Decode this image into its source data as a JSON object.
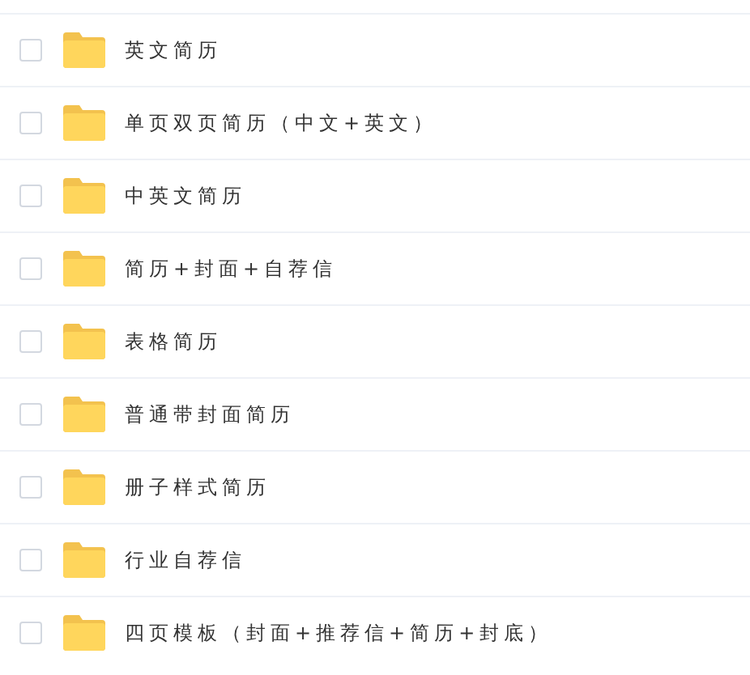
{
  "folders": [
    {
      "name": "英文简历",
      "checked": false
    },
    {
      "name": "单页双页简历（中文+英文）",
      "checked": false
    },
    {
      "name": "中英文简历",
      "checked": false
    },
    {
      "name": "简历+封面+自荐信",
      "checked": false
    },
    {
      "name": "表格简历",
      "checked": false
    },
    {
      "name": "普通带封面简历",
      "checked": false
    },
    {
      "name": "册子样式简历",
      "checked": false
    },
    {
      "name": "行业自荐信",
      "checked": false
    },
    {
      "name": "四页模板（封面+推荐信+简历+封底）",
      "checked": false
    }
  ]
}
